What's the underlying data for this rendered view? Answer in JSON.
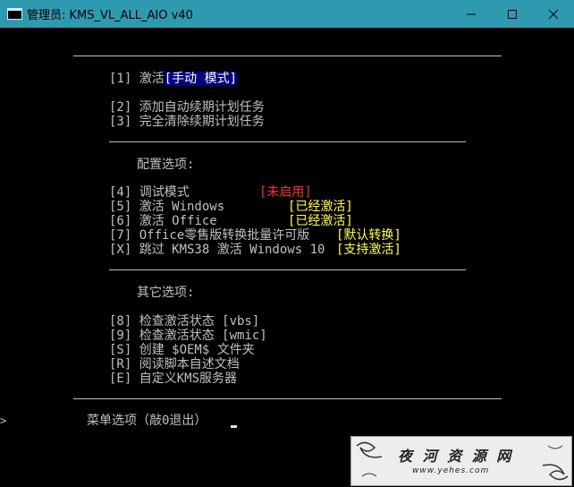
{
  "window": {
    "title": "管理员:  KMS_VL_ALL_AIO v40"
  },
  "menu": {
    "item1_key": "[1] 激活",
    "item1_tag": "[手动 模式]",
    "item2": "[2] 添加自动续期计划任务",
    "item3": "[3] 完全清除续期计划任务",
    "config_heading": "配置选项:",
    "item4_label": "[4] 调试模式",
    "item4_status": "[未启用]",
    "item5_label": "[5] 激活 Windows",
    "item5_status": "[已经激活]",
    "item6_label": "[6] 激活 Office",
    "item6_status": "[已经激活]",
    "item7_label": "[7] Office零售版转换批量许可版",
    "item7_status": "[默认转换]",
    "itemX_label": "[X] 跳过 KMS38 激活 Windows 10",
    "itemX_status": "[支持激活]",
    "other_heading": "其它选项:",
    "item8": "[8] 检查激活状态 [vbs]",
    "item9": "[9] 检查激活状态 [wmic]",
    "itemS": "[S] 创建 $OEM$ 文件夹",
    "itemR": "[R] 阅读脚本自述文档",
    "itemE": "[E] 自定义KMS服务器",
    "prompt": "菜单选项（敲0退出）"
  },
  "watermark": {
    "text": "夜 河 资 源 网",
    "url": "www.yehes.com"
  },
  "colors": {
    "titlebar": "#2e9ab0",
    "status_red": "#ff3030",
    "status_yellow": "#ffff44",
    "highlight_bg": "#000080"
  }
}
